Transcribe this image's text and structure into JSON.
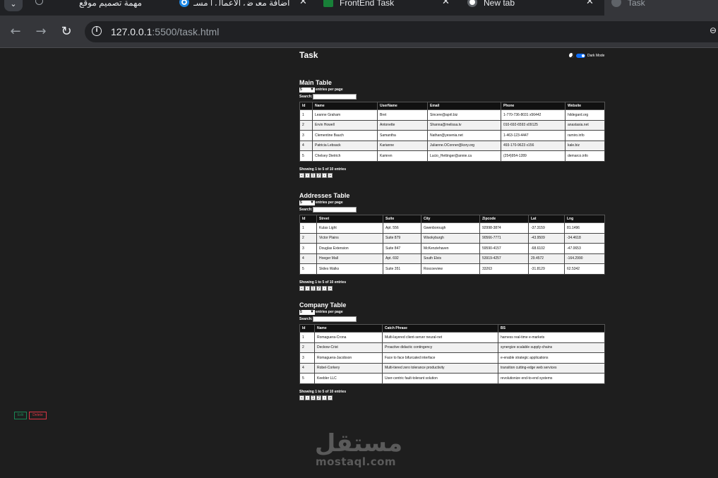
{
  "browser": {
    "tabs": [
      {
        "label": "مهمة تصميم موقع",
        "active": false
      },
      {
        "label": "إضافة معرض الأعمال | مسـ",
        "active": false
      },
      {
        "label": "FrontEnd Task",
        "active": false
      },
      {
        "label": "New tab",
        "active": false
      },
      {
        "label": "Task",
        "active": true
      }
    ],
    "url_host": "127.0.0.1",
    "url_path": ":5500/task.html"
  },
  "page": {
    "title": "Task",
    "dark_mode_label": "Dark Mode"
  },
  "common": {
    "entries_value": "5",
    "entries_label": "entries per page",
    "search_label": "Search:",
    "showing": "Showing 1 to 5 of 10 entries",
    "pager": [
      "«",
      "‹",
      "1",
      "2",
      "›",
      "»"
    ]
  },
  "main_table": {
    "title": "Main Table",
    "columns": [
      "Id",
      "Name",
      "UserName",
      "Email",
      "Phone",
      "Website"
    ],
    "rows": [
      [
        "1",
        "Leanne Graham",
        "Bret",
        "Sincere@april.biz",
        "1-770-736-8031 x56442",
        "hildegard.org"
      ],
      [
        "2",
        "Ervin Howell",
        "Antonette",
        "Shanna@melissa.tv",
        "010-692-6593 x09125",
        "anastasia.net"
      ],
      [
        "3",
        "Clementine Bauch",
        "Samantha",
        "Nathan@yesenia.net",
        "1-463-123-4447",
        "ramiro.info"
      ],
      [
        "4",
        "Patricia Lebsack",
        "Karianne",
        "Julianne.OConner@kory.org",
        "493-170-9623 x156",
        "kale.biz"
      ],
      [
        "5",
        "Chelsey Dietrich",
        "Kamren",
        "Lucio_Hettinger@annie.ca",
        "(254)954-1289",
        "demarco.info"
      ]
    ]
  },
  "addresses_table": {
    "title": "Addresses Table",
    "columns": [
      "Id",
      "Street",
      "Suite",
      "City",
      "Zipcode",
      "Lat",
      "Lng"
    ],
    "rows": [
      [
        "1",
        "Kulas Light",
        "Apt. 556",
        "Gwenborough",
        "92998-3874",
        "-37.3159",
        "81.1496"
      ],
      [
        "2",
        "Victor Plains",
        "Suite 879",
        "Wisokyburgh",
        "90566-7771",
        "-43.9509",
        "-34.4618"
      ],
      [
        "3",
        "Douglas Extension",
        "Suite 847",
        "McKenziehaven",
        "59590-4157",
        "-68.6102",
        "-47.0653"
      ],
      [
        "4",
        "Hoeger Mall",
        "Apt. 692",
        "South Elvis",
        "53919-4257",
        "29.4572",
        "-164.2990"
      ],
      [
        "5",
        "Skiles Walks",
        "Suite 351",
        "Roscoeview",
        "33263",
        "-31.8129",
        "62.5342"
      ]
    ]
  },
  "company_table": {
    "title": "Company Table",
    "columns": [
      "Id",
      "Name",
      "Catch Phrase",
      "BS"
    ],
    "rows": [
      [
        "1",
        "Romaguera-Crona",
        "Multi-layered client-server neural-net",
        "harness real-time e-markets"
      ],
      [
        "2",
        "Deckow-Crist",
        "Proactive didactic contingency",
        "synergize scalable supply-chains"
      ],
      [
        "3",
        "Romaguera-Jacobson",
        "Face to face bifurcated interface",
        "e-enable strategic applications"
      ],
      [
        "4",
        "Robel-Corkery",
        "Multi-tiered zero tolerance productivity",
        "transition cutting-edge web services"
      ],
      [
        "5",
        "Keebler LLC",
        "User-centric fault-tolerant solution",
        "revolutionize end-to-end systems"
      ]
    ]
  },
  "actions": {
    "edit_label": "Edit",
    "delete_label": "Delete"
  },
  "watermark": {
    "arabic": "مستقل",
    "latin": "mostaql.com"
  },
  "colors": {
    "page_bg": "#1e1e1e",
    "accent": "#0d6efd",
    "edit": "#198754",
    "delete": "#dc3545"
  }
}
